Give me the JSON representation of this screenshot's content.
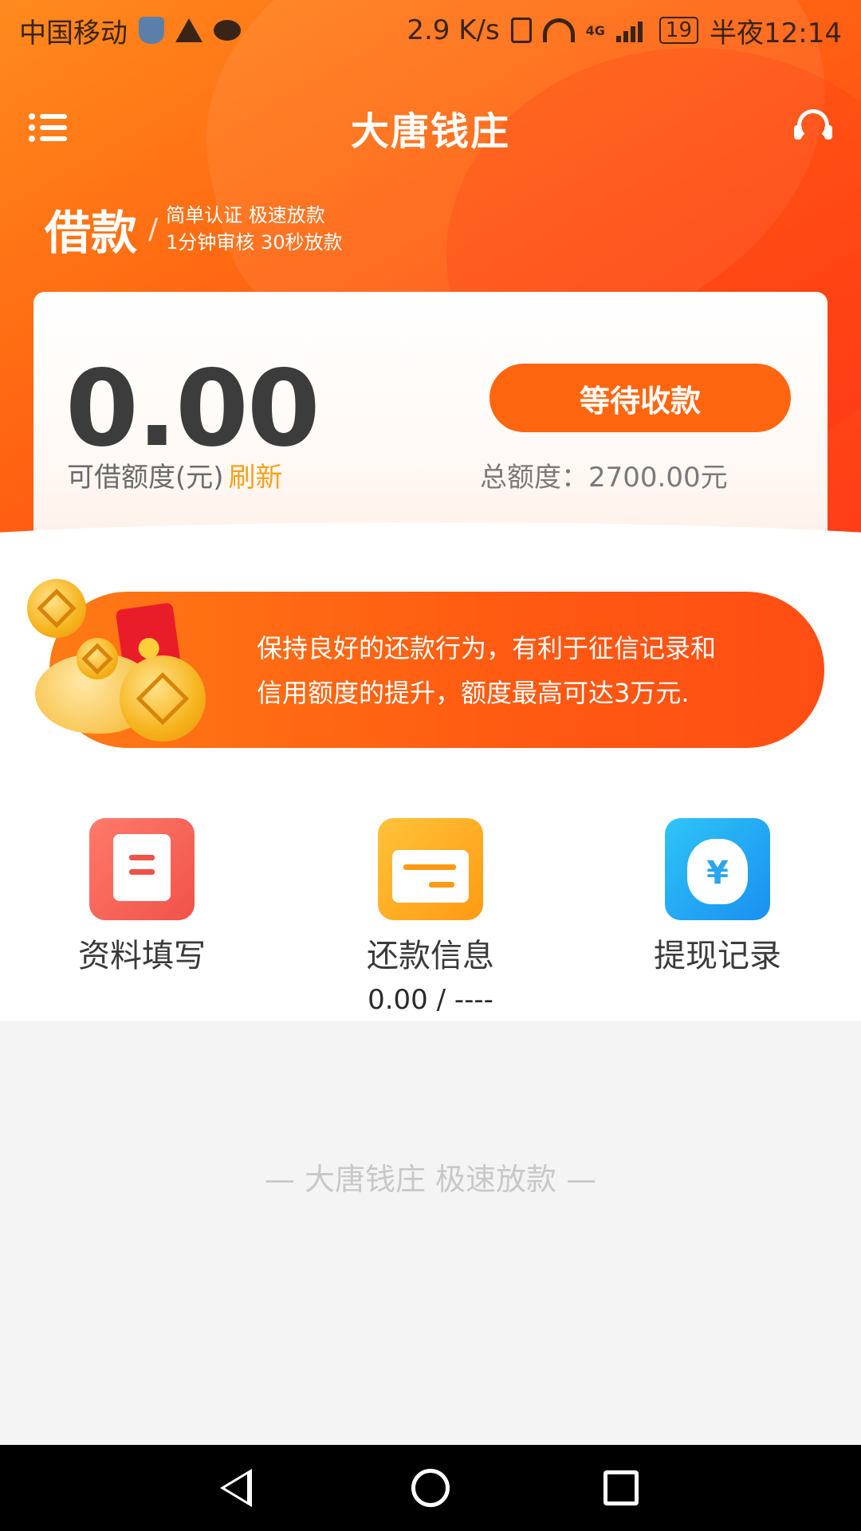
{
  "status_bar": {
    "carrier": "中国移动",
    "speed": "2.9 K/s",
    "network_badge": "4G",
    "battery": "19",
    "time": "半夜12:14"
  },
  "header": {
    "title": "大唐钱庄",
    "slogan_main": "借款",
    "slogan_line1": "简单认证  极速放款",
    "slogan_line2": "1分钟审核  30秒放款"
  },
  "credit": {
    "amount": "0.00",
    "available_label": "可借额度(元)",
    "refresh_label": "刷新",
    "wait_button": "等待收款",
    "total_label": "总额度：2700.00元"
  },
  "promo": {
    "line1": "保持良好的还款行为，有利于征信记录和",
    "line2": "信用额度的提升，额度最高可达3万元."
  },
  "actions": [
    {
      "label": "资料填写",
      "icon": "document-icon"
    },
    {
      "label": "还款信息",
      "icon": "card-icon",
      "sub": "0.00 / ----"
    },
    {
      "label": "提现记录",
      "icon": "money-bag-icon",
      "symbol": "¥"
    }
  ],
  "footer": {
    "text": "— 大唐钱庄   极速放款 —"
  },
  "colors": {
    "brand": "#ff660f",
    "accent": "#f5a21b"
  }
}
